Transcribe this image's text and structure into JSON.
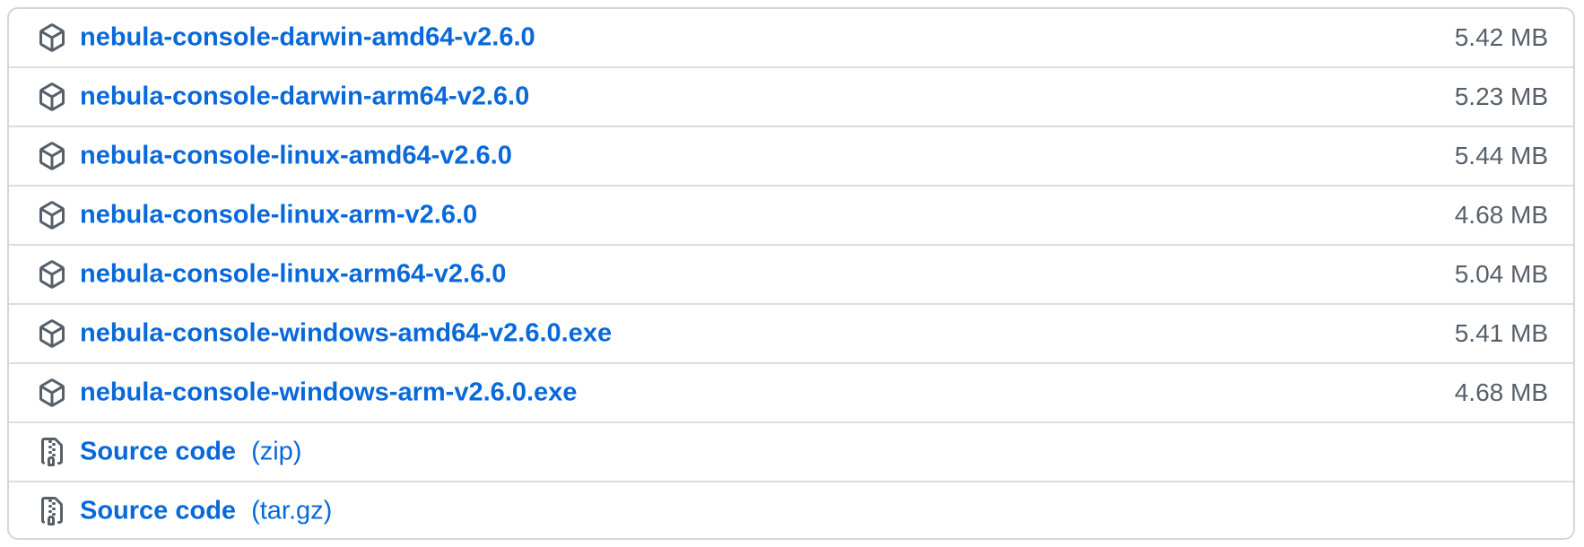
{
  "assets": [
    {
      "name": "nebula-console-darwin-amd64-v2.6.0",
      "size": "5.42 MB",
      "icon": "package-icon"
    },
    {
      "name": "nebula-console-darwin-arm64-v2.6.0",
      "size": "5.23 MB",
      "icon": "package-icon"
    },
    {
      "name": "nebula-console-linux-amd64-v2.6.0",
      "size": "5.44 MB",
      "icon": "package-icon"
    },
    {
      "name": "nebula-console-linux-arm-v2.6.0",
      "size": "4.68 MB",
      "icon": "package-icon"
    },
    {
      "name": "nebula-console-linux-arm64-v2.6.0",
      "size": "5.04 MB",
      "icon": "package-icon"
    },
    {
      "name": "nebula-console-windows-amd64-v2.6.0.exe",
      "size": "5.41 MB",
      "icon": "package-icon"
    },
    {
      "name": "nebula-console-windows-arm-v2.6.0.exe",
      "size": "4.68 MB",
      "icon": "package-icon"
    }
  ],
  "source_code": [
    {
      "label": "Source code",
      "format": "(zip)",
      "icon": "file-zip-icon"
    },
    {
      "label": "Source code",
      "format": "(tar.gz)",
      "icon": "file-zip-icon"
    }
  ],
  "colors": {
    "link": "#0969da",
    "size_text": "#57606a",
    "border": "#d0d7de",
    "icon": "#57606a"
  }
}
